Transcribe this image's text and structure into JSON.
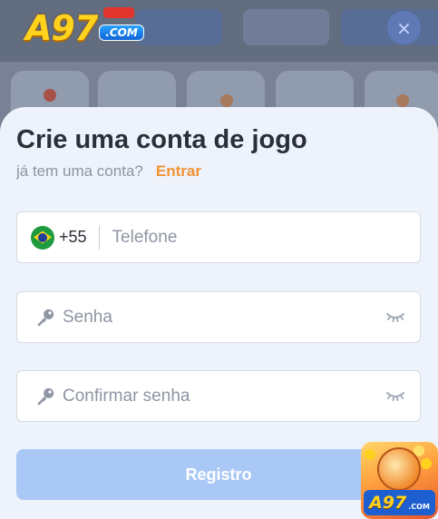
{
  "header": {
    "logo_text": "A97",
    "logo_tag": ".COM",
    "close_label": "×"
  },
  "modal": {
    "title": "Crie uma conta de jogo",
    "subtitle": "já tem uma conta?",
    "login_link": "Entrar",
    "phone": {
      "country_prefix": "+55",
      "placeholder": "Telefone",
      "value": ""
    },
    "password": {
      "placeholder": "Senha",
      "value": ""
    },
    "confirm_password": {
      "placeholder": "Confirmar senha",
      "value": ""
    },
    "register_button": "Registro"
  },
  "promo": {
    "logo_text": "A97",
    "logo_tag": ".COM"
  },
  "colors": {
    "accent_orange": "#f39233",
    "button_disabled_blue": "#a9c8f6",
    "modal_bg": "#eef2fa",
    "title_text": "#2a2f38",
    "muted_text": "#8e95a3"
  },
  "icons": {
    "close": "close-icon",
    "flag": "brazil-flag-icon",
    "key": "key-icon",
    "eye": "eye-closed-icon"
  }
}
